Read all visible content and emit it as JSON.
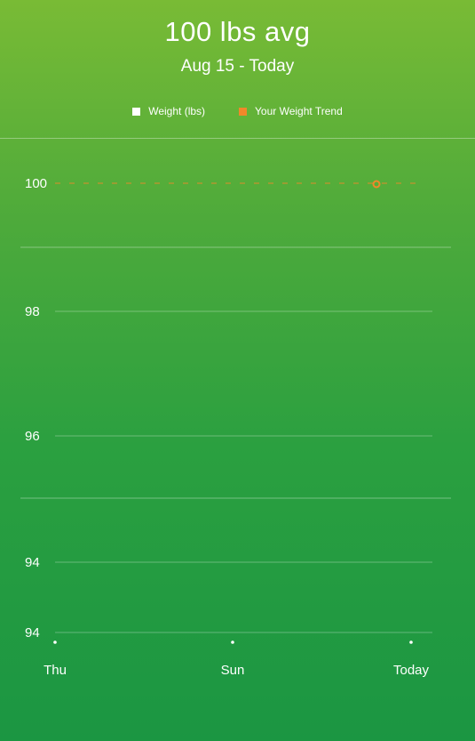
{
  "header": {
    "title": "100 lbs avg",
    "subtitle": "Aug 15 - Today"
  },
  "legend": [
    {
      "label": "Weight (lbs)",
      "color": "#ffffff"
    },
    {
      "label": "Your Weight Trend",
      "color": "#f0882a"
    }
  ],
  "chart_data": {
    "type": "line",
    "categories": [
      "Thu",
      "Sun",
      "Today"
    ],
    "y_tick_labels": [
      "100",
      "98",
      "96",
      "94",
      "94"
    ],
    "series": [
      {
        "name": "Weight (lbs)",
        "x": [
          "Today"
        ],
        "values": [
          100
        ],
        "color": "#ffffff"
      },
      {
        "name": "Your Weight Trend",
        "values": [
          100,
          100,
          100
        ],
        "color": "#f0882a",
        "dashed": true
      }
    ],
    "grid": true,
    "legend_position": "top-center"
  }
}
